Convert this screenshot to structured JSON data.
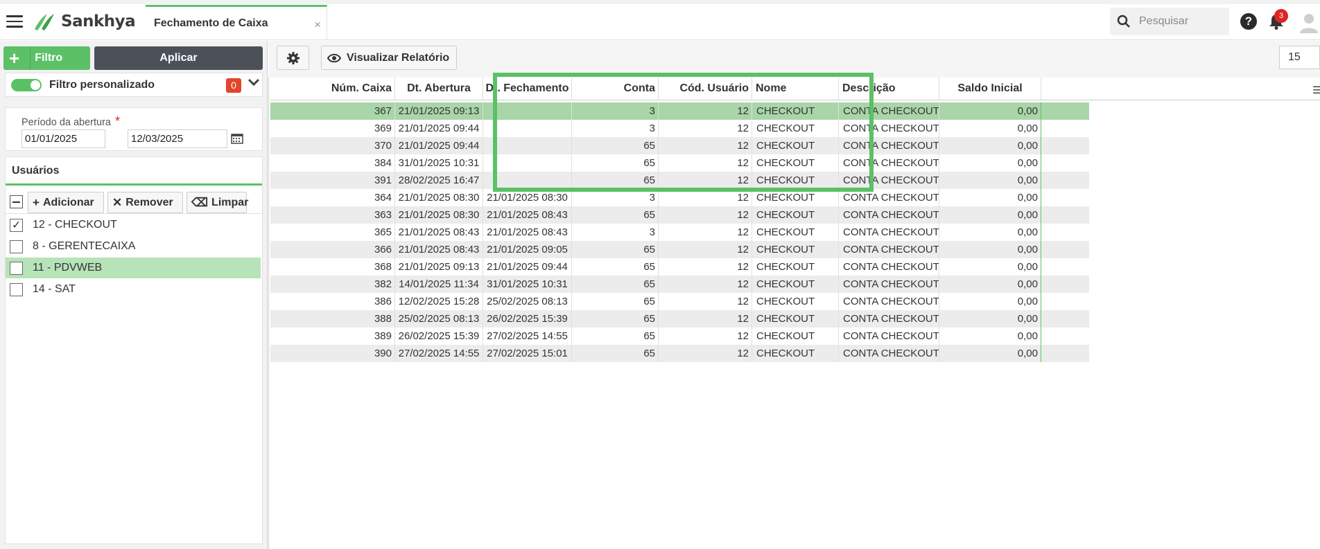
{
  "header": {
    "app_name": "Sankhya",
    "tab_title": "Fechamento de Caixa",
    "tab_close": "×",
    "search_placeholder": "Pesquisar",
    "help": "?",
    "notification_count": "3"
  },
  "sidebar": {
    "filtro_label": "Filtro",
    "aplicar_label": "Aplicar",
    "filtro_personalizado_label": "Filtro personalizado",
    "filtro_personalizado_count": "0",
    "periodo_label": "Período da abertura",
    "periodo_required": "*",
    "date_start": "01/01/2025",
    "date_end": "12/03/2025",
    "usuarios_title": "Usuários",
    "buttons": {
      "adicionar": "Adicionar",
      "remover": "Remover",
      "limpar": "Limpar"
    },
    "users": [
      {
        "label": "12 - CHECKOUT",
        "checked": true,
        "selected": false
      },
      {
        "label": "8 - GERENTECAIXA",
        "checked": false,
        "selected": false
      },
      {
        "label": "11 - PDVWEB",
        "checked": false,
        "selected": true
      },
      {
        "label": "14 - SAT",
        "checked": false,
        "selected": false
      }
    ]
  },
  "toolbar": {
    "visualizar_label": "Visualizar Relatório",
    "page_size": "15"
  },
  "grid": {
    "columns": [
      "Núm. Caixa",
      "Dt. Abertura",
      "Dt. Fechamento",
      "Conta",
      "Cód. Usuário",
      "Nome",
      "Descrição",
      "Saldo Inicial"
    ],
    "rows": [
      [
        "367",
        "21/01/2025 09:13",
        "",
        "3",
        "12",
        "CHECKOUT",
        "CONTA CHECKOUT",
        "0,00"
      ],
      [
        "369",
        "21/01/2025 09:44",
        "",
        "3",
        "12",
        "CHECKOUT",
        "CONTA CHECKOUT",
        "0,00"
      ],
      [
        "370",
        "21/01/2025 09:44",
        "",
        "65",
        "12",
        "CHECKOUT",
        "CONTA CHECKOUT",
        "0,00"
      ],
      [
        "384",
        "31/01/2025 10:31",
        "",
        "65",
        "12",
        "CHECKOUT",
        "CONTA CHECKOUT",
        "0,00"
      ],
      [
        "391",
        "28/02/2025 16:47",
        "",
        "65",
        "12",
        "CHECKOUT",
        "CONTA CHECKOUT",
        "0,00"
      ],
      [
        "364",
        "21/01/2025 08:30",
        "21/01/2025 08:30",
        "3",
        "12",
        "CHECKOUT",
        "CONTA CHECKOUT",
        "0,00"
      ],
      [
        "363",
        "21/01/2025 08:30",
        "21/01/2025 08:43",
        "65",
        "12",
        "CHECKOUT",
        "CONTA CHECKOUT",
        "0,00"
      ],
      [
        "365",
        "21/01/2025 08:43",
        "21/01/2025 08:43",
        "3",
        "12",
        "CHECKOUT",
        "CONTA CHECKOUT",
        "0,00"
      ],
      [
        "366",
        "21/01/2025 08:43",
        "21/01/2025 09:05",
        "65",
        "12",
        "CHECKOUT",
        "CONTA CHECKOUT",
        "0,00"
      ],
      [
        "368",
        "21/01/2025 09:13",
        "21/01/2025 09:44",
        "65",
        "12",
        "CHECKOUT",
        "CONTA CHECKOUT",
        "0,00"
      ],
      [
        "382",
        "14/01/2025 11:34",
        "31/01/2025 10:31",
        "65",
        "12",
        "CHECKOUT",
        "CONTA CHECKOUT",
        "0,00"
      ],
      [
        "386",
        "12/02/2025 15:28",
        "25/02/2025 08:13",
        "65",
        "12",
        "CHECKOUT",
        "CONTA CHECKOUT",
        "0,00"
      ],
      [
        "388",
        "25/02/2025 08:13",
        "26/02/2025 15:39",
        "65",
        "12",
        "CHECKOUT",
        "CONTA CHECKOUT",
        "0,00"
      ],
      [
        "389",
        "26/02/2025 15:39",
        "27/02/2025 14:55",
        "65",
        "12",
        "CHECKOUT",
        "CONTA CHECKOUT",
        "0,00"
      ],
      [
        "390",
        "27/02/2025 14:55",
        "27/02/2025 15:01",
        "65",
        "12",
        "CHECKOUT",
        "CONTA CHECKOUT",
        "0,00"
      ]
    ]
  },
  "colors": {
    "accent": "#5cc067",
    "selected_row": "#a9d5a9",
    "highlight_box": "#5cc067",
    "badge_red": "#e02424"
  }
}
